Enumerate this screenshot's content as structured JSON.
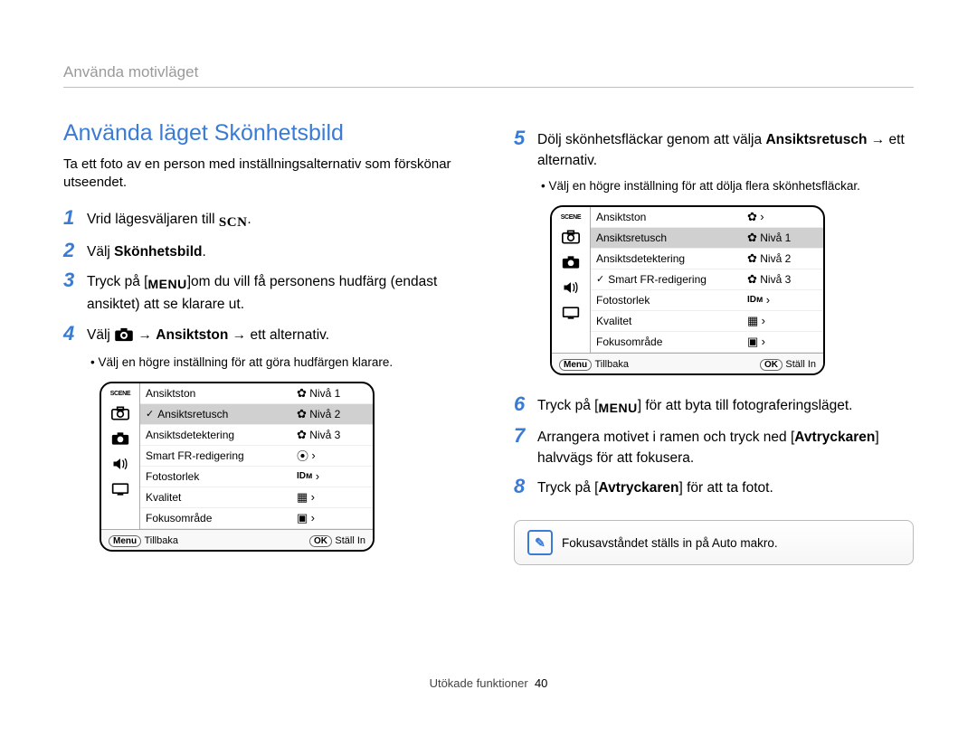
{
  "header": {
    "breadcrumb": "Använda motivläget"
  },
  "left": {
    "title": "Använda läget Skönhetsbild",
    "intro": "Ta ett foto av en person med inställningsalternativ som förskönar utseendet.",
    "steps": [
      {
        "n": "1",
        "pre": "Vrid lägesväljaren till ",
        "icon": "scn",
        "post": "."
      },
      {
        "n": "2",
        "pre": "Välj ",
        "bold": "Skönhetsbild",
        "post": "."
      },
      {
        "n": "3",
        "pre": "Tryck på [",
        "icon": "menu",
        "mid": "]om du vill få personens hudfärg (endast ansiktet) att se klarare ut."
      },
      {
        "n": "4",
        "pre": "Välj ",
        "icon": "camera",
        "mid": " → ",
        "bold": "Ansiktston",
        "post": " → ett alternativ."
      }
    ],
    "bullet": "Välj en högre inställning för att göra hudfärgen klarare.",
    "panel": {
      "scene_label": "SCENE",
      "left_icons": [
        "camera-icon",
        "camera-fill-icon",
        "speaker-icon",
        "screen-icon"
      ],
      "list": [
        "Ansiktston",
        "Ansiktsretusch",
        "Ansiktsdetektering",
        "Smart FR-redigering",
        "Fotostorlek",
        "Kvalitet",
        "Fokusområde"
      ],
      "selected_index": 1,
      "levels": [
        "Nivå 1",
        "Nivå 2",
        "Nivå 3"
      ],
      "level_selected_index": 1,
      "footer": {
        "back_btn": "Menu",
        "back_text": "Tillbaka",
        "ok_btn": "OK",
        "ok_text": "Ställ In"
      }
    }
  },
  "right": {
    "steps_a": [
      {
        "n": "5",
        "pre": "Dölj skönhetsfläckar genom att välja ",
        "bold": "Ansiktsretusch",
        "post": " → ett alternativ."
      }
    ],
    "bullet_a": "Välj en högre inställning för att dölja flera skönhetsfläckar.",
    "panel": {
      "scene_label": "SCENE",
      "left_icons": [
        "camera-icon",
        "camera-fill-icon",
        "speaker-icon",
        "screen-icon"
      ],
      "list": [
        "Ansiktston",
        "Ansiktsretusch",
        "Ansiktsdetektering",
        "Smart FR-redigering",
        "Fotostorlek",
        "Kvalitet",
        "Fokusområde"
      ],
      "selected_index": 1,
      "levels": [
        "Nivå 1",
        "Nivå 2",
        "Nivå 3"
      ],
      "level_selected_index": 1,
      "footer": {
        "back_btn": "Menu",
        "back_text": "Tillbaka",
        "ok_btn": "OK",
        "ok_text": "Ställ In"
      }
    },
    "steps_b": [
      {
        "n": "6",
        "pre": "Tryck på [",
        "icon": "menu",
        "post": "] för att byta till fotograferingsläget."
      },
      {
        "n": "7",
        "pre": "Arrangera motivet i ramen och tryck ned [",
        "bold": "Avtryckaren",
        "post": "] halvvägs för att fokusera."
      },
      {
        "n": "8",
        "pre": "Tryck på [",
        "bold": "Avtryckaren",
        "post": "] för att ta fotot."
      }
    ],
    "note": {
      "pre": "Fokusavståndet ställs in på ",
      "bold": "Auto makro",
      "post": "."
    }
  },
  "footer": {
    "text": "Utökade funktioner",
    "page": "40"
  }
}
